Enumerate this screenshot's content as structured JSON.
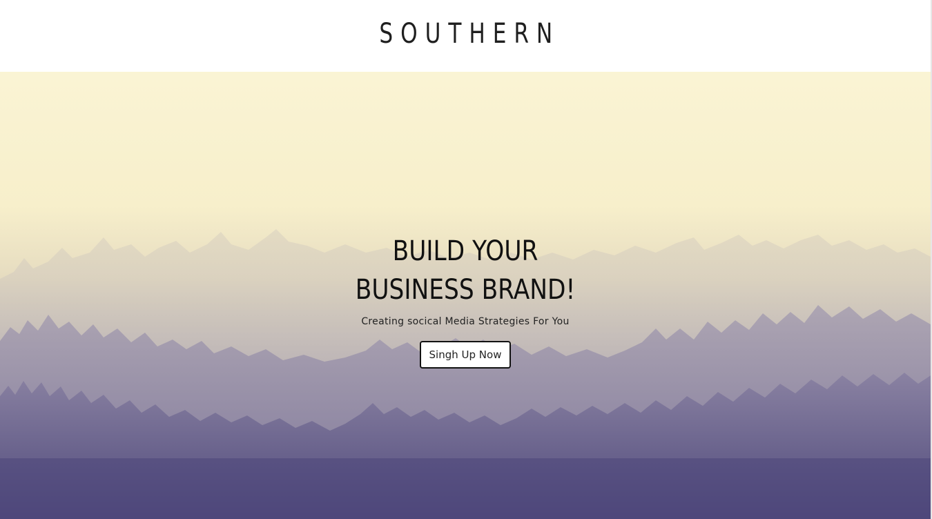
{
  "header": {
    "brand": "SOUTHERN"
  },
  "hero": {
    "title": "BUILD YOUR BUSINESS BRAND!",
    "subtitle": "Creating socical Media Strategies For You",
    "cta_label": "Singh Up Now",
    "background_icon": "misty-forest-photo"
  },
  "colors": {
    "header_bg": "#ffffff",
    "sky_top": "#faf4d4",
    "forest_bottom": "#57517f",
    "button_border": "#111111"
  }
}
